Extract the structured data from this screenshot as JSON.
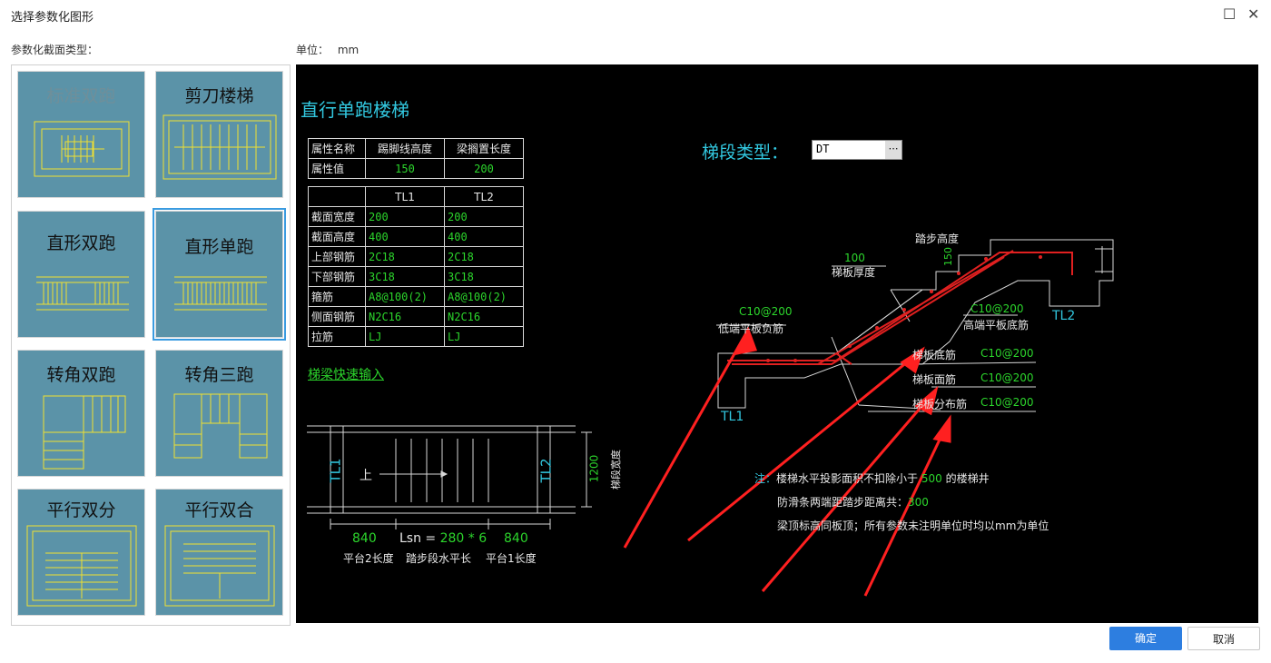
{
  "window": {
    "title": "选择参数化图形"
  },
  "labels": {
    "section_type": "参数化截面类型：",
    "unit_label": "单位：",
    "unit_value": "mm"
  },
  "gallery": [
    {
      "label": "标准双跑"
    },
    {
      "label": "剪刀楼梯"
    },
    {
      "label": "直形双跑"
    },
    {
      "label": "直形单跑"
    },
    {
      "label": "转角双跑"
    },
    {
      "label": "转角三跑"
    },
    {
      "label": "平行双分"
    },
    {
      "label": "平行双合"
    }
  ],
  "drawing": {
    "title": "直行单跑楼梯",
    "segment_type_label": "梯段类型：",
    "segment_type_value": "DT",
    "attr_table": {
      "headers": [
        "属性名称",
        "踢脚线高度",
        "梁搁置长度"
      ],
      "row_label": "属性值",
      "values": [
        "150",
        "200"
      ]
    },
    "beam_table": {
      "cols": [
        "TL1",
        "TL2"
      ],
      "rows": [
        {
          "label": "截面宽度",
          "tl1": "200",
          "tl2": "200"
        },
        {
          "label": "截面高度",
          "tl1": "400",
          "tl2": "400"
        },
        {
          "label": "上部钢筋",
          "tl1": "2C18",
          "tl2": "2C18"
        },
        {
          "label": "下部钢筋",
          "tl1": "3C18",
          "tl2": "3C18"
        },
        {
          "label": "箍筋",
          "tl1": "A8@100(2)",
          "tl2": "A8@100(2)"
        },
        {
          "label": "侧面钢筋",
          "tl1": "N2C16",
          "tl2": "N2C16"
        },
        {
          "label": "拉筋",
          "tl1": "LJ",
          "tl2": "LJ"
        }
      ]
    },
    "quick_input": "梯梁快速输入",
    "plan": {
      "tl1": "TL1",
      "tl2": "TL2",
      "up": "上",
      "width_value": "1200",
      "width_label": "梯段宽度",
      "dim_left": "840",
      "dim_mid_prefix": "Lsn =",
      "dim_mid_value": "280 * 6",
      "dim_right": "840",
      "lbl_left": "平台2长度",
      "lbl_mid": "踏步段水平长",
      "lbl_right": "平台1长度"
    },
    "section": {
      "step_height_label": "踏步高度",
      "step_height_value": "150",
      "thickness_value": "100",
      "thickness_label": "梯板厚度",
      "low_rebar_value": "C10@200",
      "low_rebar_label": "低端平板负筋",
      "high_rebar_value": "C10@200",
      "high_rebar_label": "高端平板底筋",
      "tl1": "TL1",
      "tl2": "TL2",
      "bottom_bar_label": "梯板底筋",
      "bottom_bar_value": "C10@200",
      "top_bar_label": "梯板面筋",
      "top_bar_value": "C10@200",
      "dist_bar_label": "梯板分布筋",
      "dist_bar_value": "C10@200"
    },
    "notes": {
      "prefix": "注：",
      "line1_a": "楼梯水平投影面积不扣除小于",
      "line1_value": "500",
      "line1_b": "的楼梯井",
      "line2_a": "防滑条两端距踏步距离共：",
      "line2_value": "300",
      "line3": "梁顶标高同板顶；所有参数未注明单位时均以mm为单位"
    }
  },
  "buttons": {
    "ok": "确定",
    "cancel": "取消"
  },
  "colors": {
    "accent": "#2d7ee0",
    "cad_bg": "#000000",
    "tile_bg": "#5b93a8",
    "cad_cyan": "#32c8e0",
    "cad_green": "#2cd62c",
    "rebar_red": "#e02020",
    "arrow_red": "#ff2020",
    "yellow": "#f0e030"
  }
}
